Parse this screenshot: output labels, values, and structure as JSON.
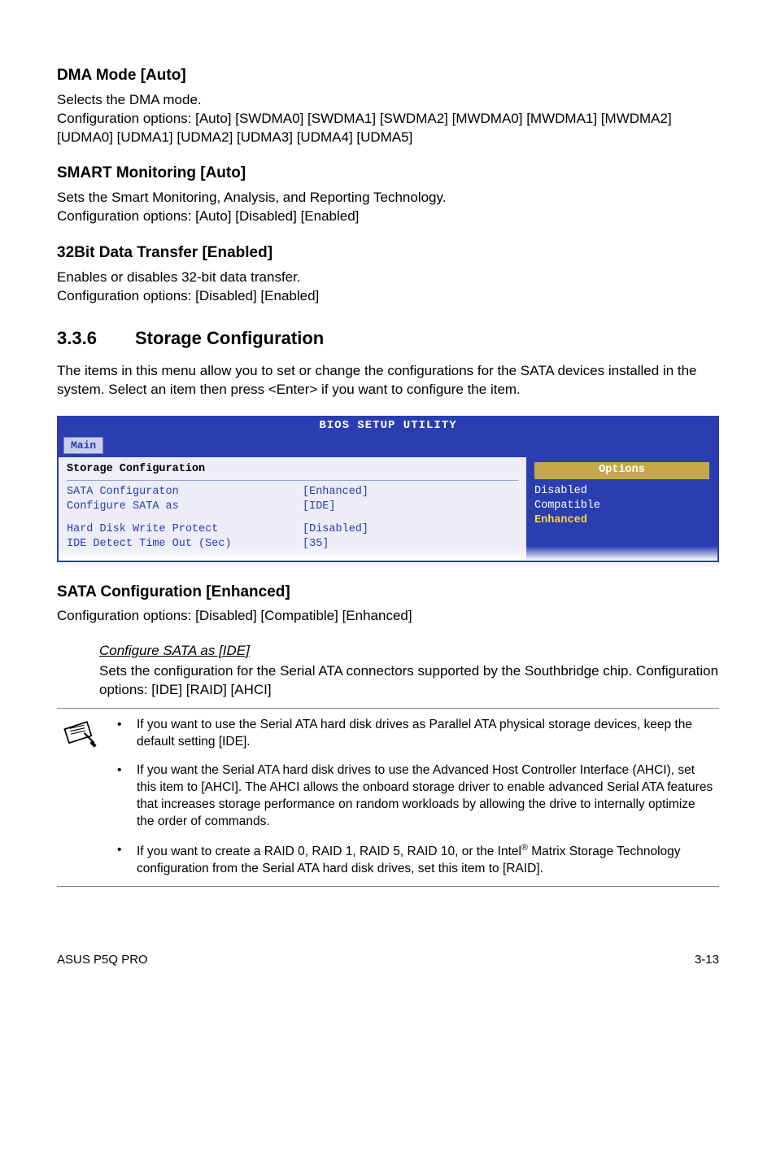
{
  "dma": {
    "title": "DMA Mode [Auto]",
    "line1": "Selects the DMA mode.",
    "line2": "Configuration options: [Auto] [SWDMA0] [SWDMA1] [SWDMA2] [MWDMA0] [MWDMA1] [MWDMA2] [UDMA0] [UDMA1] [UDMA2] [UDMA3] [UDMA4] [UDMA5]"
  },
  "smart": {
    "title": "SMART Monitoring [Auto]",
    "line1": "Sets the Smart Monitoring, Analysis, and Reporting Technology.",
    "line2": "Configuration options: [Auto] [Disabled] [Enabled]"
  },
  "bit32": {
    "title": "32Bit Data Transfer [Enabled]",
    "line1": "Enables or disables 32-bit data transfer.",
    "line2": "Configuration options: [Disabled] [Enabled]"
  },
  "section": {
    "num": "3.3.6",
    "title": "Storage Configuration",
    "intro": "The items in this menu allow you to set or change the configurations for the SATA devices installed in the system. Select an item then press <Enter> if you want to configure the item."
  },
  "bios": {
    "utility_title": "BIOS SETUP UTILITY",
    "tab": "Main",
    "panel_title": "Storage Configuration",
    "rows": {
      "r0l": "SATA Configuraton",
      "r0v": "[Enhanced]",
      "r1l": " Configure SATA as",
      "r1v": "[IDE]",
      "r2l": "Hard Disk Write Protect",
      "r2v": "[Disabled]",
      "r3l": "IDE Detect Time Out (Sec)",
      "r3v": "[35]"
    },
    "options_title": "Options",
    "opt0": "Disabled",
    "opt1": "Compatible",
    "opt2": "Enhanced"
  },
  "sataconf": {
    "title": "SATA Configuration [Enhanced]",
    "line1": "Configuration options: [Disabled] [Compatible] [Enhanced]",
    "sub_title": "Configure SATA as [IDE]",
    "sub_body": "Sets the configuration for the Serial ATA connectors supported by the Southbridge chip. Configuration options: [IDE] [RAID] [AHCI]"
  },
  "notes": {
    "n0": "If you want to use the Serial ATA hard disk drives as Parallel ATA physical storage devices, keep the default setting [IDE].",
    "n1": "If you want the Serial ATA hard disk drives to use the Advanced Host Controller Interface (AHCI), set this item to [AHCI]. The AHCI allows the onboard storage driver to enable advanced Serial ATA features that increases storage performance on random workloads by allowing the drive to internally optimize the order of commands.",
    "n2a": "If you want to create a RAID 0, RAID 1, RAID 5, RAID 10, or the Intel",
    "n2b": " Matrix Storage Technology configuration from the Serial ATA hard disk drives, set this item to [RAID]."
  },
  "footer": {
    "left": "ASUS P5Q PRO",
    "right": "3-13"
  }
}
